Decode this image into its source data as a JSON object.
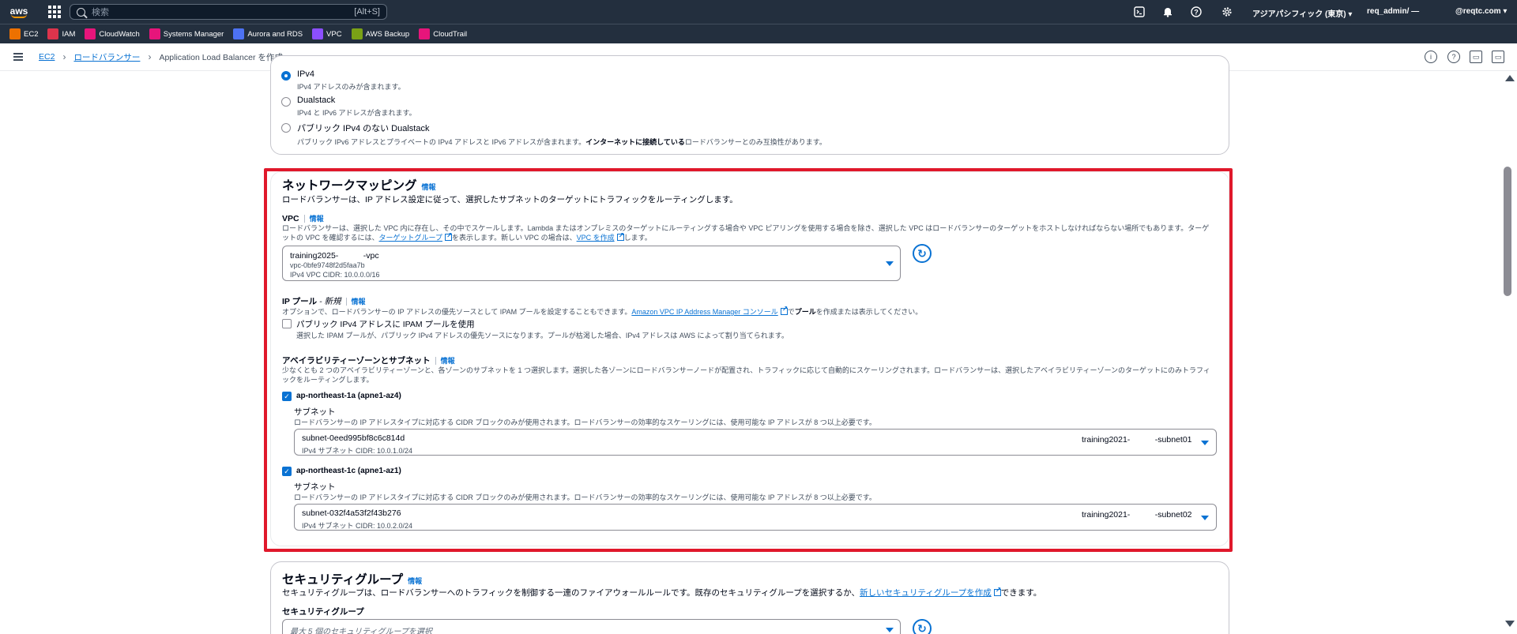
{
  "topnav": {
    "logo": "aws",
    "search_placeholder": "検索",
    "search_shortcut": "[Alt+S]",
    "region": "アジアパシフィック (東京)",
    "user": "req_admin/",
    "account_suffix": "@reqtc.com"
  },
  "favorites": [
    {
      "label": "EC2",
      "color": "#ed7100"
    },
    {
      "label": "IAM",
      "color": "#dd344c"
    },
    {
      "label": "CloudWatch",
      "color": "#e7157b"
    },
    {
      "label": "Systems Manager",
      "color": "#e7157b"
    },
    {
      "label": "Aurora and RDS",
      "color": "#4d72f3"
    },
    {
      "label": "VPC",
      "color": "#8c4fff"
    },
    {
      "label": "AWS Backup",
      "color": "#7aa116"
    },
    {
      "label": "CloudTrail",
      "color": "#e7157b"
    }
  ],
  "breadcrumb": {
    "items": [
      "EC2",
      "ロードバランサー"
    ],
    "current": "Application Load Balancer を作成"
  },
  "ip_type": {
    "options": [
      {
        "label": "IPv4",
        "desc": "IPv4 アドレスのみが含まれます。",
        "checked": true
      },
      {
        "label": "Dualstack",
        "desc": "IPv4 と IPv6 アドレスが含まれます。",
        "checked": false
      },
      {
        "label": "パブリック IPv4 のない Dualstack",
        "desc_pre": "パブリック IPv6 アドレスとプライベートの IPv4 アドレスと IPv6 アドレスが含まれます。",
        "desc_bold": "インターネットに接続している",
        "desc_post": "ロードバランサーとのみ互換性があります。",
        "checked": false
      }
    ]
  },
  "network_mapping": {
    "title": "ネットワークマッピング",
    "info": "情報",
    "desc": "ロードバランサーは、IP アドレス設定に従って、選択したサブネットのターゲットにトラフィックをルーティングします。",
    "vpc": {
      "label": "VPC",
      "info": "情報",
      "desc_line1": "ロードバランサーは、選択した VPC 内に存在し、その中でスケールします。Lambda またはオンプレミスのターゲットにルーティングする場合や VPC ピアリングを使用する場合を除き、選択した VPC はロードバランサーのターゲットをホストしなければならない場所でもあります。ターゲ",
      "desc_line2_pre": "ットの VPC を確認するには、",
      "link_target_group": "ターゲットグループ",
      "desc_line2_mid": "を表示します。新しい VPC の場合は、",
      "link_create_vpc": "VPC を作成",
      "desc_line2_post": "します。",
      "selected_name": "training2025-　　　-vpc",
      "selected_id": "vpc-0bfe9748f2d5faa7b",
      "selected_cidr": "IPv4 VPC CIDR: 10.0.0.0/16"
    },
    "ip_pool": {
      "label": "IP プール",
      "label_suffix": "- 新規",
      "info": "情報",
      "desc_pre": "オプションで、ロードバランサーの IP アドレスの優先ソースとして IPAM プールを設定することもできます。",
      "link": "Amazon VPC IP Address Manager コンソール",
      "desc_post_bold": "プール",
      "desc_post": "を作成または表示してください。",
      "checkbox_label": "パブリック IPv4 アドレスに IPAM プールを使用",
      "checkbox_desc": "選択した IPAM プールが、パブリック IPv4 アドレスの優先ソースになります。プールが枯渇した場合、IPv4 アドレスは AWS によって割り当てられます。"
    },
    "az": {
      "label": "アベイラビリティーゾーンとサブネット",
      "info": "情報",
      "desc_line1": "少なくとも 2 つのアベイラビリティーゾーンと、各ゾーンのサブネットを 1 つ選択します。選択した各ゾーンにロードバランサーノードが配置され、トラフィックに応じて自動的にスケーリングされます。ロードバランサーは、選択したアベイラビリティーゾーンのターゲットにのみトラフィ",
      "desc_line2": "ックをルーティングします。",
      "zones": [
        {
          "name": "ap-northeast-1a (apne1-az4)",
          "subnet_label": "サブネット",
          "subnet_desc": "ロードバランサーの IP アドレスタイプに対応する CIDR ブロックのみが使用されます。ロードバランサーの効率的なスケーリングには、使用可能な IP アドレスが 8 つ以上必要です。",
          "subnet_id": "subnet-0eed995bf8c6c814d",
          "subnet_cidr": "IPv4 サブネット CIDR: 10.0.1.0/24",
          "subnet_name": "training2021-　　　-subnet01"
        },
        {
          "name": "ap-northeast-1c (apne1-az1)",
          "subnet_label": "サブネット",
          "subnet_desc": "ロードバランサーの IP アドレスタイプに対応する CIDR ブロックのみが使用されます。ロードバランサーの効率的なスケーリングには、使用可能な IP アドレスが 8 つ以上必要です。",
          "subnet_id": "subnet-032f4a53f2f43b276",
          "subnet_cidr": "IPv4 サブネット CIDR: 10.0.2.0/24",
          "subnet_name": "training2021-　　　-subnet02"
        }
      ]
    }
  },
  "security_groups": {
    "title": "セキュリティグループ",
    "info": "情報",
    "desc_pre": "セキュリティグループは、ロードバランサーへのトラフィックを制御する一連のファイアウォールルールです。既存のセキュリティグループを選択するか、",
    "link": "新しいセキュリティグループを作成",
    "desc_post": "できます。",
    "field_label": "セキュリティグループ",
    "placeholder": "最大 5 個のセキュリティグループを選択"
  }
}
